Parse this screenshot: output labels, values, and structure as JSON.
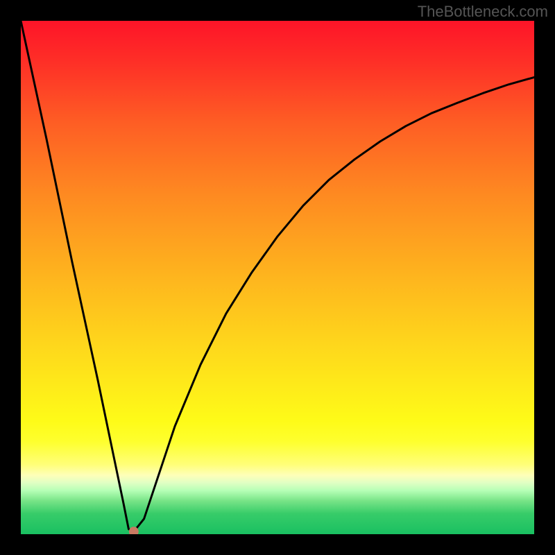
{
  "watermark": "TheBottleneck.com",
  "colors": {
    "frame": "#000000",
    "line": "#000000",
    "marker": "#c97a62",
    "gradient_top": "#fe1428",
    "gradient_bottom": "#1ac061"
  },
  "chart_data": {
    "type": "line",
    "title": "",
    "xlabel": "",
    "ylabel": "",
    "xlim": [
      0,
      100
    ],
    "ylim": [
      0,
      100
    ],
    "grid": false,
    "legend": false,
    "x": [
      0,
      5,
      10,
      15,
      20,
      21,
      22,
      24,
      30,
      35,
      40,
      45,
      50,
      55,
      60,
      65,
      70,
      75,
      80,
      85,
      90,
      95,
      100
    ],
    "values": [
      100,
      77,
      53,
      30,
      6,
      1,
      0.5,
      3,
      21,
      33,
      43,
      51,
      58,
      64,
      69,
      73,
      76.5,
      79.5,
      82,
      84,
      85.9,
      87.6,
      89
    ],
    "marker": {
      "x": 22,
      "y": 0.5
    },
    "annotations": []
  }
}
